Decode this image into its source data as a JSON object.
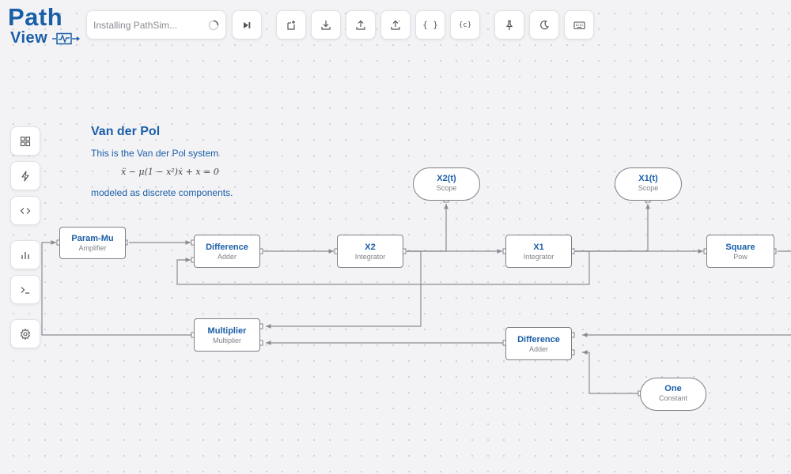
{
  "logo": {
    "line1": "Path",
    "line2": "View"
  },
  "status": {
    "text": "Installing PathSim..."
  },
  "toolbar": {
    "buttons": [
      {
        "name": "run-step-button",
        "icon": "skip-forward-icon"
      },
      {
        "name": "new-file-button",
        "icon": "new-file-icon"
      },
      {
        "name": "download-button",
        "icon": "download-icon"
      },
      {
        "name": "upload-button",
        "icon": "upload-icon"
      },
      {
        "name": "export-button",
        "icon": "export-icon"
      },
      {
        "name": "json-button",
        "icon": "braces-icon",
        "label": "{ }"
      },
      {
        "name": "code-export-button",
        "icon": "code-braces-icon",
        "label": "{c}"
      },
      {
        "name": "pin-button",
        "icon": "pin-icon"
      },
      {
        "name": "dark-mode-button",
        "icon": "moon-icon"
      },
      {
        "name": "keyboard-button",
        "icon": "keyboard-icon"
      }
    ]
  },
  "sidebar": {
    "buttons": [
      {
        "name": "blocks-button",
        "icon": "grid-icon"
      },
      {
        "name": "events-button",
        "icon": "lightning-icon"
      },
      {
        "name": "code-button",
        "icon": "code-icon"
      },
      {
        "name": "plot-button",
        "icon": "bar-chart-icon"
      },
      {
        "name": "console-button",
        "icon": "terminal-icon"
      },
      {
        "name": "settings-button",
        "icon": "gear-icon"
      }
    ]
  },
  "note": {
    "title": "Van der Pol",
    "line1": "This is the Van der Pol system",
    "equation": "ẍ − μ(1 − x²)ẋ + x = 0",
    "line2": "modeled as discrete components."
  },
  "nodes": {
    "param_mu": {
      "name": "Param-Mu",
      "type": "Amplifier"
    },
    "difference_top": {
      "name": "Difference",
      "type": "Adder"
    },
    "x2": {
      "name": "X2",
      "type": "Integrator"
    },
    "x1": {
      "name": "X1",
      "type": "Integrator"
    },
    "square": {
      "name": "Square",
      "type": "Pow"
    },
    "x2_scope": {
      "name": "X2(t)",
      "type": "Scope"
    },
    "x1_scope": {
      "name": "X1(t)",
      "type": "Scope"
    },
    "multiplier": {
      "name": "Multiplier",
      "type": "Multiplier"
    },
    "difference_bottom": {
      "name": "Difference",
      "type": "Adder"
    },
    "one": {
      "name": "One",
      "type": "Constant"
    }
  },
  "colors": {
    "accent": "#1a5ea8",
    "wire": "#8a8a92",
    "node_border": "#7f7f88"
  }
}
